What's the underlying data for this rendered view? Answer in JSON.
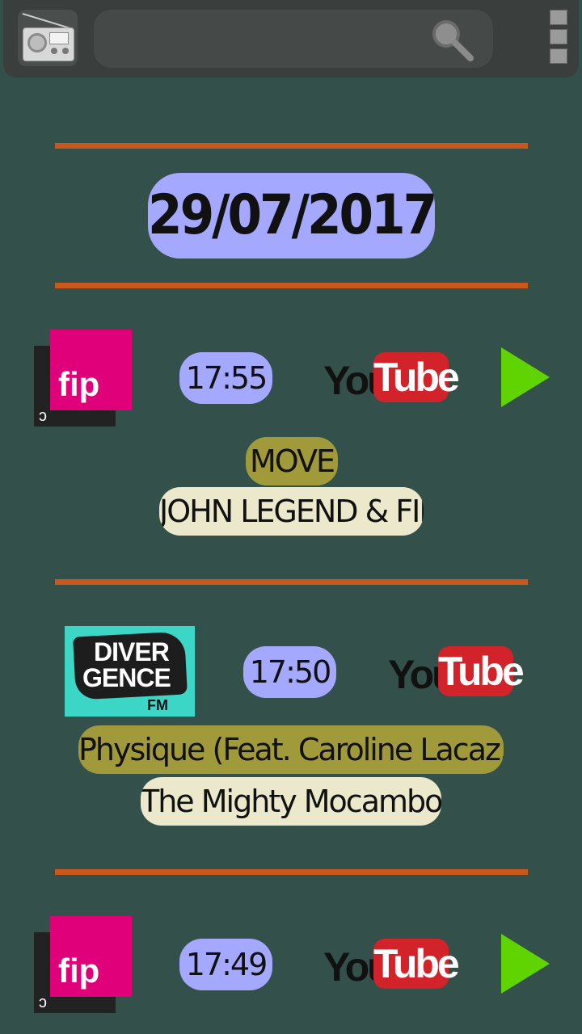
{
  "header": {
    "app_icon": "radio-icon",
    "search_icon": "search-icon",
    "menu_icon": "menu-icon"
  },
  "date": "29/07/2017",
  "tracks": [
    {
      "station_logo": "fip",
      "time": "17:55",
      "youtube_you": "You",
      "youtube_tube": "Tube",
      "title": "MOVE",
      "artist": "JOHN LEGEND & FINK",
      "play_icon": "play-icon"
    },
    {
      "station_logo": "DIVERGENCE FM",
      "logo_line1": "DIVER",
      "logo_line2": "GENCE",
      "logo_line3": "FM",
      "time": "17:50",
      "youtube_you": "You",
      "youtube_tube": "Tube",
      "title": "Physique (Feat. Caroline Lacaz...",
      "artist": "The Mighty Mocambos"
    },
    {
      "station_logo": "fip",
      "time": "17:49",
      "youtube_you": "You",
      "youtube_tube": "Tube",
      "play_icon": "play-icon"
    }
  ],
  "colors": {
    "background": "#33504b",
    "divider": "#c8581b",
    "time_pill": "#a5a8ff",
    "title_pill": "#a09a3a",
    "artist_pill": "#ebe8cc",
    "fip_pink": "#e0007a",
    "youtube_red": "#d2232a",
    "play_green": "#5fd400"
  }
}
